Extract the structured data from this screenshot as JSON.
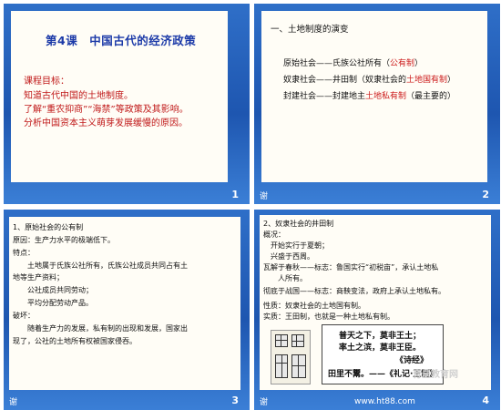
{
  "slide1": {
    "number": "1",
    "title": "第4课　中国古代的经济政策",
    "objectives": [
      "课程目标：",
      "知道古代中国的土地制度。",
      "了解“重农抑商”“海禁”等政策及其影响。",
      "分析中国资本主义萌芽发展缓慢的原因。"
    ]
  },
  "slide2": {
    "number": "2",
    "note": "谢",
    "heading": "一、土地制度的演变",
    "rows": [
      {
        "label": "原始社会——",
        "text": "氏族公社所有（",
        "red": "公有制",
        "end": "）"
      },
      {
        "label": "奴隶社会——",
        "text": "井田制（奴隶社会的",
        "red": "土地国有制",
        "end": "）"
      },
      {
        "label": "封建社会——",
        "text": "",
        "red": "土地私有制",
        "pre": "封建地主",
        "end": "（最主要的）"
      }
    ]
  },
  "slide3": {
    "number": "3",
    "note": "谢",
    "lines": [
      {
        "t": "1、原始社会的公有制",
        "c": ""
      },
      {
        "t": "原因：生产力水平的极端低下。",
        "c": ""
      },
      {
        "t": "特点：",
        "c": ""
      },
      {
        "t": "　　土地属于氏族公社所有，氏族公社成员共同占有土",
        "c": "blue"
      },
      {
        "t": "地等生产资料；",
        "c": "blue"
      },
      {
        "t": "　　公社成员共同劳动；",
        "c": "blue"
      },
      {
        "t": "　　平均分配劳动产品。",
        "c": "blue"
      },
      {
        "t": "破坏：",
        "c": ""
      },
      {
        "t": "　　随着生产力的发展，私有制的出现和发展，国家出",
        "c": "mix"
      },
      {
        "t": "现了，公社的土地所有权被国家侵吞。",
        "c": "blue"
      }
    ]
  },
  "slide4": {
    "number": "4",
    "note": "谢",
    "lines": [
      {
        "t": "2、奴隶社会的井田制",
        "c": ""
      },
      {
        "t": "概况：",
        "c": ""
      },
      {
        "t": "　开始实行于夏朝；",
        "c": "blue"
      },
      {
        "t": "　兴盛于西周。",
        "c": "blue"
      },
      {
        "t": "瓦解于春秋——标志：鲁国实行“初税亩”，承认土地私",
        "c": "blue"
      },
      {
        "t": "　　人所有。",
        "c": "blue"
      },
      {
        "t": "彻底于战国——标志：商鞅变法，政府上承认土地私有。",
        "c": "blue"
      },
      {
        "t": "性质：奴隶社会的土地国有制。",
        "c": "mix"
      },
      {
        "t": "实质：王田制，也就是一种土地私有制。",
        "c": "mix"
      }
    ],
    "poem": [
      "普天之下，莫非王土；",
      "率土之滨，莫非王臣。",
      "《诗经》",
      "田里不鬻。——《礼记·王制》"
    ],
    "watermark": "育星教育网",
    "url": "www.ht88.com"
  }
}
